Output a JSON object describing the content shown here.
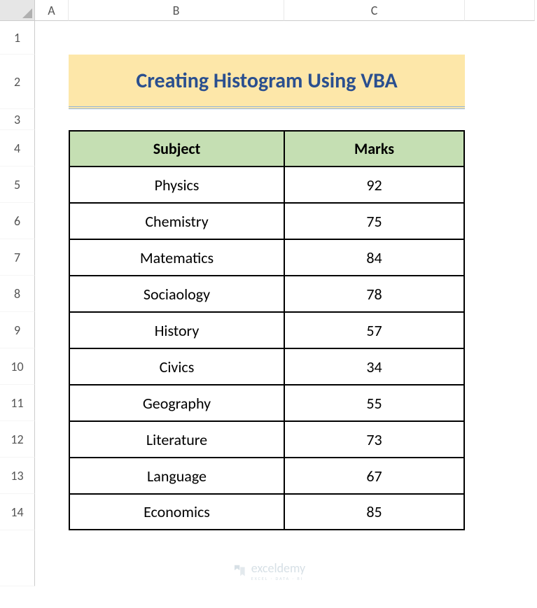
{
  "columns": [
    "A",
    "B",
    "C"
  ],
  "rows": [
    "1",
    "2",
    "3",
    "4",
    "5",
    "6",
    "7",
    "8",
    "9",
    "10",
    "11",
    "12",
    "13",
    "14"
  ],
  "title": "Creating Histogram Using VBA",
  "table": {
    "headers": [
      "Subject",
      "Marks"
    ],
    "data": [
      {
        "subject": "Physics",
        "marks": "92"
      },
      {
        "subject": "Chemistry",
        "marks": "75"
      },
      {
        "subject": "Matematics",
        "marks": "84"
      },
      {
        "subject": "Sociaology",
        "marks": "78"
      },
      {
        "subject": "History",
        "marks": "57"
      },
      {
        "subject": "Civics",
        "marks": "34"
      },
      {
        "subject": "Geography",
        "marks": "55"
      },
      {
        "subject": "Literature",
        "marks": "73"
      },
      {
        "subject": "Language",
        "marks": "67"
      },
      {
        "subject": "Economics",
        "marks": "85"
      }
    ]
  },
  "watermark": {
    "text": "exceldemy",
    "sub": "EXCEL · DATA · BI"
  }
}
